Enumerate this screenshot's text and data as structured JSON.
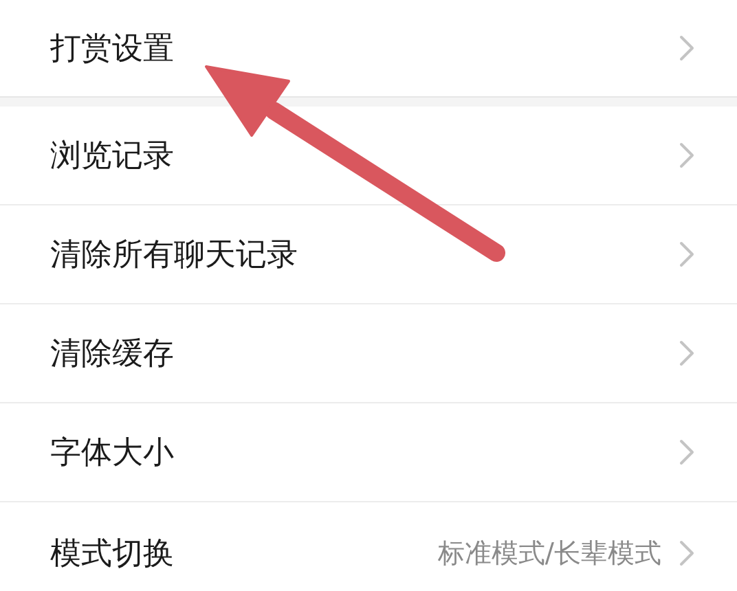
{
  "sections": [
    {
      "rows": [
        {
          "label": "打赏设置"
        }
      ]
    },
    {
      "rows": [
        {
          "label": "浏览记录"
        },
        {
          "label": "清除所有聊天记录"
        },
        {
          "label": "清除缓存"
        },
        {
          "label": "字体大小"
        },
        {
          "label": "模式切换",
          "value": "标准模式/长辈模式"
        }
      ]
    }
  ]
}
